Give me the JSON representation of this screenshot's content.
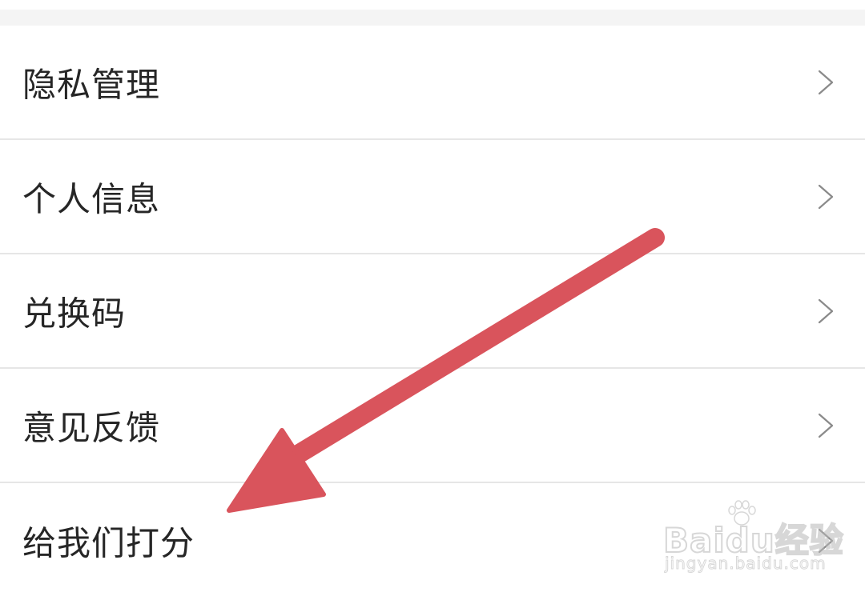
{
  "menu": {
    "items": [
      {
        "label": "隐私管理"
      },
      {
        "label": "个人信息"
      },
      {
        "label": "兑换码"
      },
      {
        "label": "意见反馈"
      },
      {
        "label": "给我们打分"
      }
    ]
  },
  "annotation": {
    "arrow_color": "#d9545c"
  },
  "watermark": {
    "logo_text": "Baidu经验",
    "url_text": "jingyan.baidu.com"
  },
  "colors": {
    "text": "#262626",
    "divider": "#e6e6e6",
    "chevron": "#8a8a8a",
    "background": "#ffffff"
  },
  "icons": {
    "row_chevron": "chevron-right-icon"
  }
}
